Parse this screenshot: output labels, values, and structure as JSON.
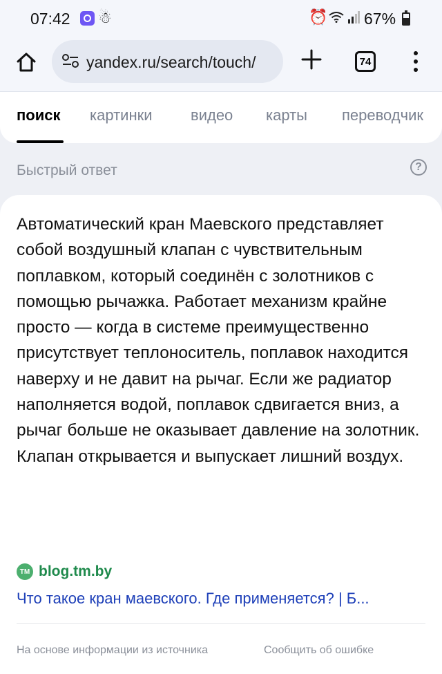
{
  "status_bar": {
    "time": "07:42",
    "battery_percent": "67%",
    "icons": [
      "app-notification-icon",
      "person-icon",
      "alarm-icon",
      "wifi-icon",
      "signal-icon",
      "battery-icon"
    ]
  },
  "browser": {
    "url": "yandex.ru/search/touch/",
    "tab_count": "74",
    "icons": [
      "home-icon",
      "site-settings-icon",
      "plus-icon",
      "tabs-icon",
      "more-vert-icon"
    ]
  },
  "nav": {
    "tabs": [
      {
        "label": "поиск",
        "active": true
      },
      {
        "label": "картинки"
      },
      {
        "label": "видео"
      },
      {
        "label": "карты"
      },
      {
        "label": "переводчик"
      }
    ]
  },
  "quick_answer": {
    "title": "Быстрый ответ",
    "help_icon": "?",
    "text": "Автоматический кран Маевского представляет собой воздушный клапан с чувствительным поплавком, который соединён с золотников с помощью рычажка. Работает механизм крайне просто — когда в системе преимущественно присутствует теплоноситель, поплавок находится наверху и не давит на рычаг. Если же радиатор наполняется водой, поплавок сдвигается вниз, а рычаг больше не оказывает давление на золотник. Клапан открывается и выпускает лишний воздух.",
    "source": {
      "logo_text": "TM",
      "domain": "blog.tm.by",
      "link_text": "Что такое кран маевского. Где применяется? | Б..."
    },
    "footer": {
      "based_on": "На основе информации из источника",
      "report": "Сообщить об ошибке"
    }
  },
  "colors": {
    "accent_link": "#1d3fb8",
    "source_green": "#1f8a4c",
    "muted_text": "#8a8f99"
  }
}
